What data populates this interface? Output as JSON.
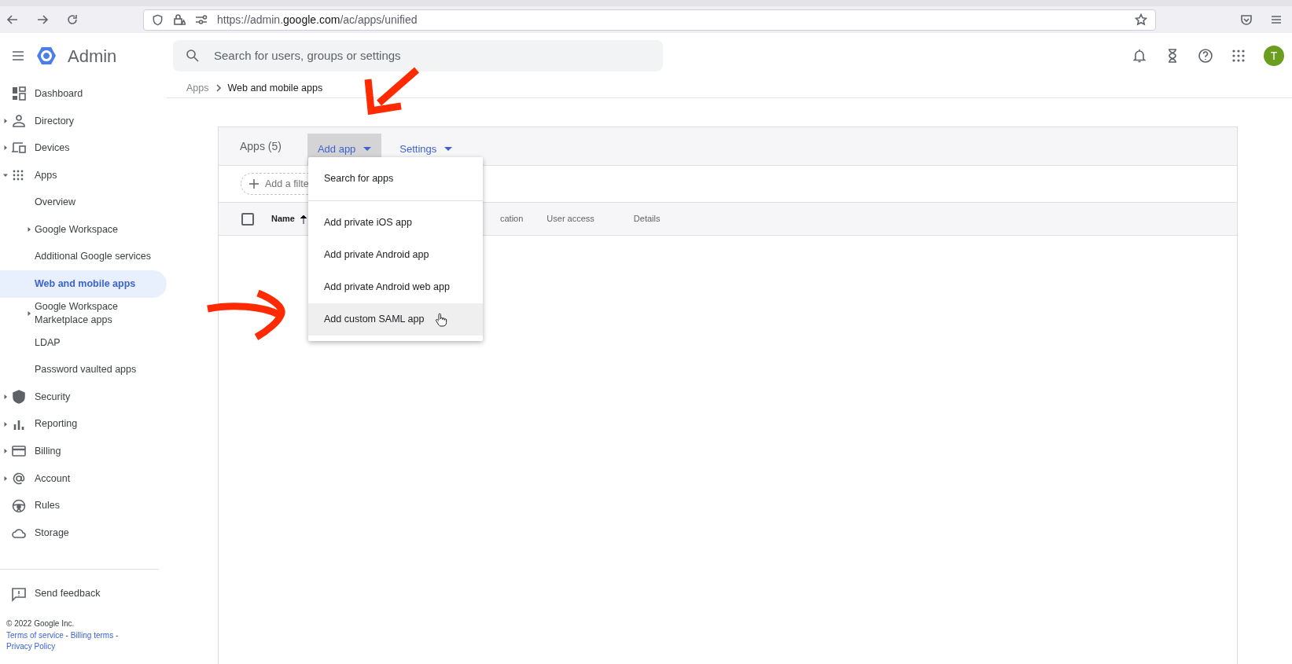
{
  "browser": {
    "url": "https://admin.**google.com**/ac/apps/unified"
  },
  "header": {
    "product": "Admin",
    "search": {
      "placeholder": "Search for users, groups or settings"
    },
    "avatar": "T"
  },
  "breadcrumb": [
    "Apps",
    "Web and mobile apps"
  ],
  "sidebar": {
    "items": [
      {
        "label": "Dashboard",
        "selected": false
      },
      {
        "label": "Directory",
        "expanded": false,
        "selected": false
      },
      {
        "label": "Devices",
        "expanded": false,
        "selected": false
      },
      {
        "label": "Apps",
        "expanded": true,
        "selected": false,
        "children": [
          {
            "label": "Overview",
            "selected": false
          },
          {
            "label": "Google Workspace",
            "expanded": false,
            "selected": false
          },
          {
            "label": "Additional Google services",
            "selected": false
          },
          {
            "label": "Web and mobile apps",
            "selected": true
          },
          {
            "label": "Google Workspace Marketplace apps",
            "expanded": false,
            "selected": false
          },
          {
            "label": "LDAP",
            "selected": false
          },
          {
            "label": "Password vaulted apps",
            "selected": false
          }
        ]
      },
      {
        "label": "Security",
        "expanded": false,
        "selected": false
      },
      {
        "label": "Reporting",
        "expanded": false,
        "selected": false
      },
      {
        "label": "Billing",
        "expanded": false,
        "selected": false
      },
      {
        "label": "Account",
        "expanded": false,
        "selected": false
      },
      {
        "label": "Rules",
        "selected": false
      },
      {
        "label": "Storage",
        "selected": false
      }
    ],
    "feedback": "Send feedback",
    "copyright": "© 2022 Google Inc.",
    "links": [
      "Terms of service",
      "Billing terms",
      "Privacy Policy"
    ],
    "separator": "-"
  },
  "apps_card": {
    "title": "Apps (5)",
    "actions": [
      {
        "label": "Add app",
        "open": true
      },
      {
        "label": "Settings",
        "open": false
      }
    ],
    "filter": {
      "placeholder": "Add a filte"
    },
    "select_all": {
      "checked": false
    },
    "columns": [
      {
        "label": "Name",
        "sorted": true
      },
      {
        "label": "cation",
        "sorted": false
      },
      {
        "label": "User access",
        "sorted": false
      },
      {
        "label": "Details",
        "sorted": false
      }
    ]
  },
  "menu": {
    "sections": [
      [
        {
          "label": "Search for apps",
          "highlighted": false
        }
      ],
      [
        {
          "label": "Add private iOS app",
          "highlighted": false
        },
        {
          "label": "Add private Android app",
          "highlighted": false
        },
        {
          "label": "Add private Android web app",
          "highlighted": false
        },
        {
          "label": "Add custom SAML app",
          "highlighted": true
        }
      ]
    ]
  }
}
